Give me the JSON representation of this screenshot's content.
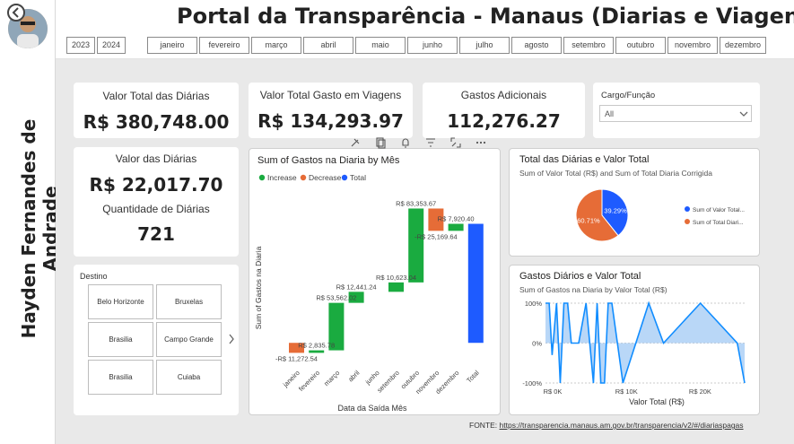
{
  "sidebar": {
    "author": "Hayden Fernandes de Andrade"
  },
  "header": {
    "title": "Portal da Transparência - Manaus (Diarias e Viagens)",
    "years": [
      "2023",
      "2024"
    ],
    "months": [
      "janeiro",
      "fevereiro",
      "março",
      "abril",
      "maio",
      "junho",
      "julho",
      "agosto",
      "setembro",
      "outubro",
      "novembro",
      "dezembro"
    ]
  },
  "kpis": {
    "total_diarias_label": "Valor Total das Diárias",
    "total_diarias_value": "R$ 380,748.00",
    "gasto_viagens_label": "Valor Total Gasto em Viagens",
    "gasto_viagens_value": "R$ 134,293.97",
    "gastos_adicionais_label": "Gastos Adicionais",
    "gastos_adicionais_value": "112,276.27",
    "valor_diarias_label": "Valor das Diárias",
    "valor_diarias_value": "R$ 22,017.70",
    "quantidade_label": "Quantidade de Diárias",
    "quantidade_value": "721"
  },
  "filter": {
    "label": "Cargo/Função",
    "selected": "All"
  },
  "destino": {
    "label": "Destino",
    "items": [
      "Belo Horizonte",
      "Bruxelas",
      "Brasilia",
      "Campo Grande",
      "Brasilia",
      "Cuiaba"
    ]
  },
  "visual_toolbar": [
    "pin-icon",
    "copy-icon",
    "bell-icon",
    "filter-icon",
    "focus-icon",
    "more-icon"
  ],
  "waterfall": {
    "title": "Sum of Gastos na Diaria by Mês",
    "legend": [
      "Increase",
      "Decrease",
      "Total"
    ],
    "xlabel": "Data da Saída Mês",
    "ylabel": "Sum of Gastos na Diaria",
    "categories": [
      "janeiro",
      "fevereiro",
      "março",
      "abril",
      "junho",
      "setembro",
      "outubro",
      "novembro",
      "dezembro",
      "Total"
    ],
    "labels": [
      "-R$ 11,272.54",
      "R$ 2,835.78",
      "R$ 53,562.02",
      "R$ 12,441.24",
      "",
      "R$ 10,623.04",
      "R$ 83,353.67",
      "-R$ 25,169.64",
      "R$ 7,920.40",
      ""
    ]
  },
  "pie": {
    "title": "Total das Diárias e Valor Total",
    "subtitle": "Sum of Valor Total (R$) and Sum of Total Diaria Corrigida",
    "legend": [
      "Sum of Valor Total...",
      "Sum of Total Diari..."
    ],
    "labels": [
      "39.29%",
      "60.71%"
    ]
  },
  "area": {
    "title": "Gastos Diários e Valor Total",
    "subtitle": "Sum of Gastos na Diaria by Valor Total (R$)",
    "xlabel": "Valor Total (R$)",
    "yticks": [
      "100%",
      "0%",
      "-100%"
    ],
    "xticks": [
      "R$ 0K",
      "R$ 10K",
      "R$ 20K"
    ]
  },
  "footer": {
    "prefix": "FONTE: ",
    "link": "https://transparencia.manaus.am.gov.br/transparencia/v2/#/diariaspagas"
  },
  "colors": {
    "increase": "#1aab40",
    "decrease": "#e66c37",
    "total": "#1e5bff",
    "area_line": "#118dff",
    "area_fill": "#a8cdf5"
  },
  "chart_data": [
    {
      "type": "bar",
      "subtype": "waterfall",
      "title": "Sum of Gastos na Diaria by Mês",
      "xlabel": "Data da Saída Mês",
      "ylabel": "Sum of Gastos na Diaria",
      "categories": [
        "janeiro",
        "fevereiro",
        "março",
        "abril",
        "junho",
        "setembro",
        "outubro",
        "novembro",
        "dezembro",
        "Total"
      ],
      "values": [
        -11272.54,
        2835.78,
        53562.02,
        12441.24,
        0,
        10623.04,
        83353.67,
        -25169.64,
        7920.4,
        134293.97
      ]
    },
    {
      "type": "pie",
      "title": "Total das Diárias e Valor Total",
      "categories": [
        "Sum of Valor Total (R$)",
        "Sum of Total Diaria Corrigida"
      ],
      "values": [
        39.29,
        60.71
      ]
    },
    {
      "type": "area",
      "title": "Gastos Diários e Valor Total",
      "xlabel": "Valor Total (R$)",
      "ylim": [
        -100,
        100
      ],
      "x": [
        0,
        500,
        900,
        1500,
        2000,
        2500,
        3000,
        3500,
        4500,
        5500,
        6500,
        7000,
        7500,
        8000,
        8500,
        9000,
        10500,
        14000,
        16000,
        21000,
        26000,
        27000
      ],
      "y": [
        100,
        100,
        -30,
        100,
        -100,
        100,
        100,
        0,
        0,
        100,
        -100,
        100,
        -100,
        -100,
        100,
        100,
        -100,
        100,
        0,
        100,
        0,
        -100
      ]
    }
  ]
}
